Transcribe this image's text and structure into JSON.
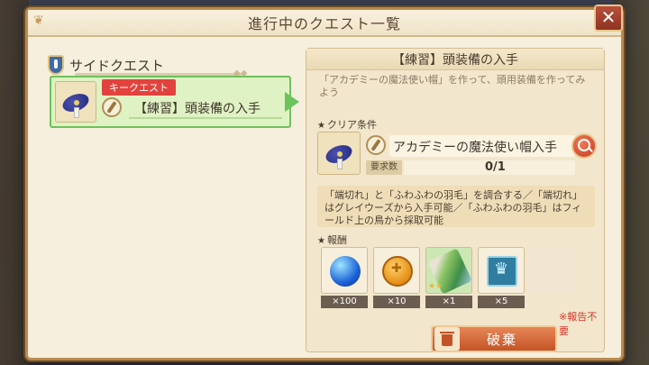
{
  "dialog": {
    "title": "進行中のクエスト一覧",
    "close_glyph": "✕"
  },
  "sidebar": {
    "section_label": "サイドクエスト",
    "quests": [
      {
        "badge": "キークエスト",
        "name": "【練習】頭装備の入手",
        "selected": true,
        "icon": "wizard-hat-icon"
      }
    ]
  },
  "detail": {
    "title": "【練習】頭装備の入手",
    "description": "「アカデミーの魔法使い帽」を作って、頭用装備を作ってみよう",
    "clear_condition": {
      "label": "クリア条件",
      "item_name": "アカデミーの魔法使い帽入手",
      "requirement_label": "要求数",
      "requirement_value": "0/1"
    },
    "hint": "「端切れ」と「ふわふわの羽毛」を調合する／「端切れ」はグレイウーズから入手可能／「ふわふわの羽毛」はフィールド上の鳥から採取可能",
    "rewards": {
      "label": "報酬",
      "items": [
        {
          "icon": "blue-orb-icon",
          "count": "×100"
        },
        {
          "icon": "gold-coin-icon",
          "count": "×10"
        },
        {
          "icon": "wand-icon",
          "count": "×1",
          "rarity_stars": "★★"
        },
        {
          "icon": "crown-tile-icon",
          "count": "×5"
        }
      ],
      "note": "※報告不要"
    },
    "discard_button": "破棄"
  },
  "colors": {
    "selected_border": "#6cc25b",
    "key_badge": "#e2423d",
    "discard_button": "#c45426",
    "note_red": "#d6362b"
  }
}
